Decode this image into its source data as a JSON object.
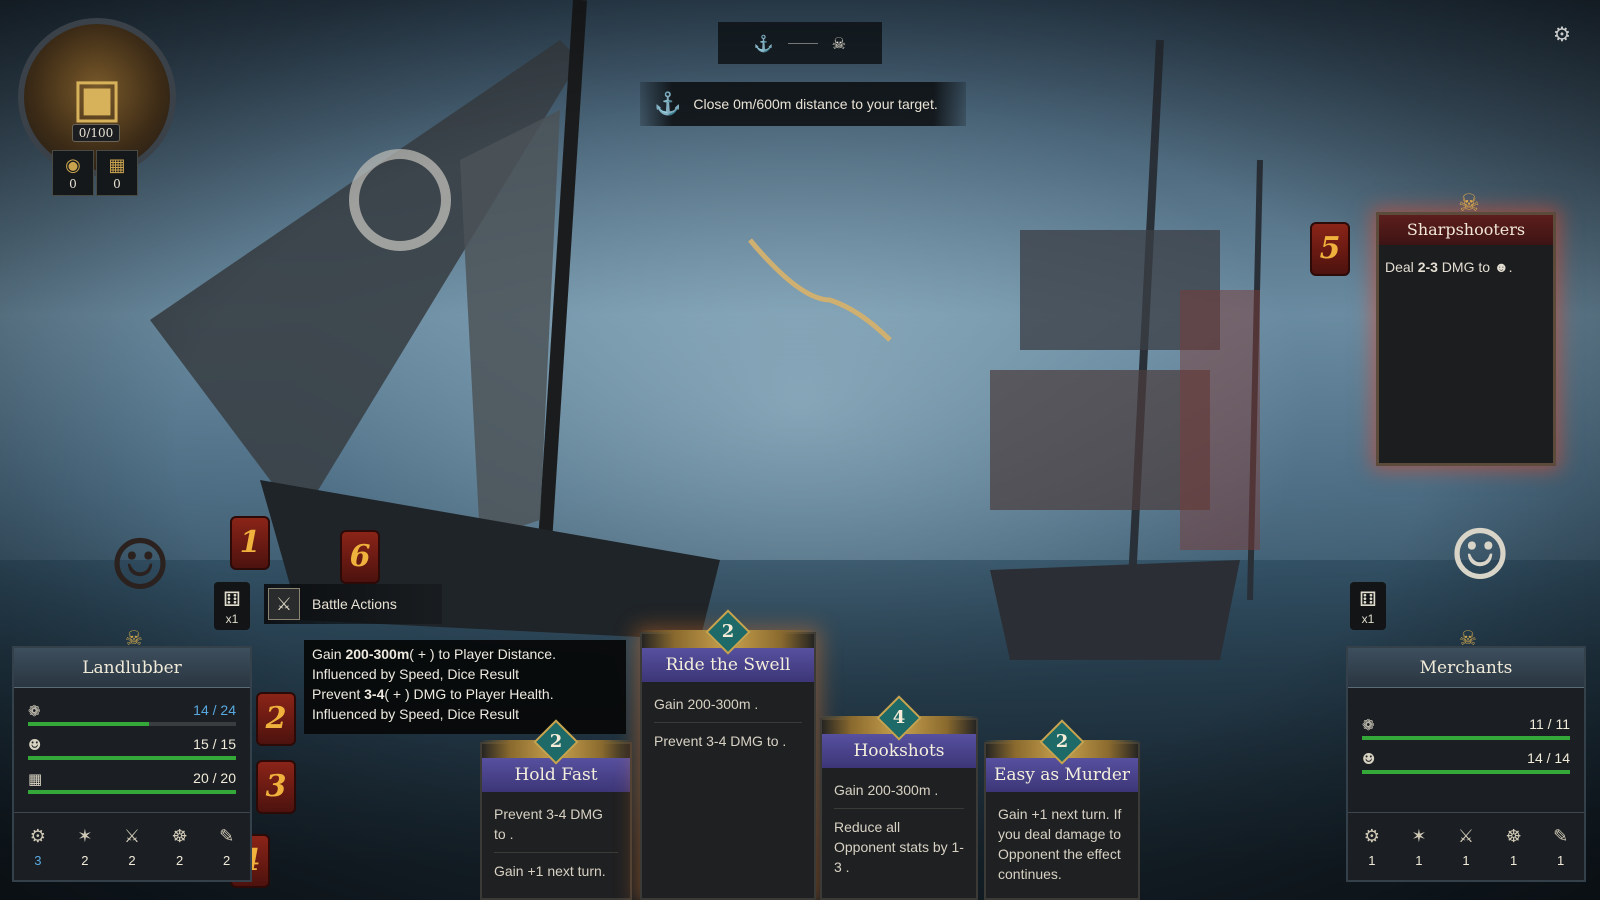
{
  "colors": {
    "health_bar": "#35a83a",
    "enemy_title_bg": "#5c1e1c",
    "card_title_bg": "#5750a0",
    "cost_gem": "#1d6a68",
    "highlight_blue": "#59a9e0",
    "dice_badge": "#8a2418"
  },
  "hud": {
    "treasure": {
      "icon": "treasure-chest-icon",
      "count": "0/100"
    },
    "resources": [
      {
        "icon": "gold-coin-icon",
        "value": "0"
      },
      {
        "icon": "cargo-crate-icon",
        "value": "0"
      }
    ],
    "objective_top": {
      "left_icon": "player-ship-icon",
      "right_icon": "enemy-ship-icon"
    },
    "objective": {
      "icon": "distance-icon",
      "text": "Close 0m/600m distance to your target."
    },
    "settings_icon": "settings-gear-icon"
  },
  "enemy_card": {
    "badge": "5",
    "title": "Sharpshooters",
    "desc_prefix": "Deal ",
    "desc_value": "2-3",
    "desc_suffix": " DMG to ",
    "desc_end": "."
  },
  "dice_badges_left": [
    "1",
    "6",
    "2",
    "3",
    "4"
  ],
  "player": {
    "name": "Landlubber",
    "dice_count": "x1",
    "stats": [
      {
        "icon": "health-icon",
        "value": "14 / 24",
        "fill": 0.5833
      },
      {
        "icon": "crew-icon",
        "value": "15 / 15",
        "fill": 1
      },
      {
        "icon": "cargo-icon",
        "value": "20 / 20",
        "fill": 1
      }
    ],
    "attributes": [
      {
        "icon": "speed-icon",
        "value": "3"
      },
      {
        "icon": "cannon-icon",
        "value": "2"
      },
      {
        "icon": "boarding-icon",
        "value": "2"
      },
      {
        "icon": "helm-icon",
        "value": "2"
      },
      {
        "icon": "scroll-icon",
        "value": "2"
      }
    ]
  },
  "opponent": {
    "name": "Merchants",
    "dice_count": "x1",
    "stats": [
      {
        "icon": "health-icon",
        "value": "11 / 11",
        "fill": 1
      },
      {
        "icon": "crew-icon",
        "value": "14 / 14",
        "fill": 1
      }
    ],
    "attributes": [
      {
        "icon": "speed-icon",
        "value": "1"
      },
      {
        "icon": "cannon-icon",
        "value": "1"
      },
      {
        "icon": "boarding-icon",
        "value": "1"
      },
      {
        "icon": "helm-icon",
        "value": "1"
      },
      {
        "icon": "scroll-icon",
        "value": "1"
      }
    ]
  },
  "battle_actions": {
    "icon": "crossed-swords-icon",
    "label": "Battle Actions"
  },
  "tooltip": {
    "line1_a": "Gain ",
    "line1_b": "200-300m",
    "line1_c": "( + ) to Player ",
    "line1_d": "Distance.",
    "line2": "Influenced by  Speed,  Dice Result",
    "line3_a": "Prevent ",
    "line3_b": "3-4",
    "line3_c": "( + ) DMG to Player ",
    "line3_d": "Health.",
    "line4": "Influenced by  Speed,  Dice Result"
  },
  "cards": [
    {
      "cost": "2",
      "title": "Hold Fast",
      "p1": "Prevent 3-4 DMG to .",
      "p2": "Gain +1  next turn."
    },
    {
      "cost": "2",
      "title": "Ride the Swell",
      "p1": "Gain 200-300m .",
      "p2": "Prevent 3-4 DMG to ."
    },
    {
      "cost": "4",
      "title": "Hookshots",
      "p1": "Gain 200-300m .",
      "p2": "Reduce all Opponent stats by 1-3 ."
    },
    {
      "cost": "2",
      "title": "Easy as Murder",
      "p1": "Gain +1  next turn. If you deal damage to Opponent  the effect continues."
    }
  ]
}
